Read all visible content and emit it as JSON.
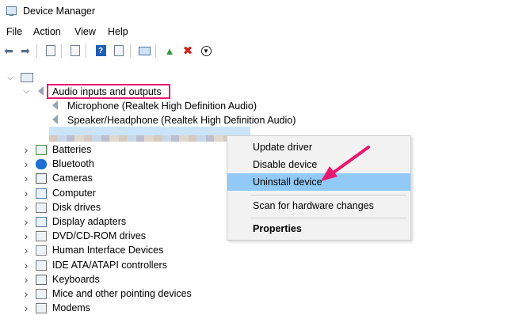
{
  "window": {
    "title": "Device Manager"
  },
  "menu": [
    "File",
    "Action",
    "View",
    "Help"
  ],
  "toolbar_icons": [
    "back-arrow-icon",
    "forward-arrow-icon",
    "properties-icon",
    "show-hide-icon",
    "help-icon",
    "details-icon",
    "monitor-icon",
    "update-driver-icon",
    "uninstall-icon",
    "download-icon"
  ],
  "tree": {
    "root_label": "",
    "audio_category": "Audio inputs and outputs",
    "audio_children": [
      "Microphone (Realtek High Definition Audio)",
      "Speaker/Headphone (Realtek High Definition Audio)"
    ],
    "categories": [
      "Batteries",
      "Bluetooth",
      "Cameras",
      "Computer",
      "Disk drives",
      "Display adapters",
      "DVD/CD-ROM drives",
      "Human Interface Devices",
      "IDE ATA/ATAPI controllers",
      "Keyboards",
      "Mice and other pointing devices",
      "Modems"
    ]
  },
  "context_menu": {
    "items": [
      "Update driver",
      "Disable device",
      "Uninstall device",
      "Scan for hardware changes",
      "Properties"
    ],
    "highlighted": "Uninstall device"
  },
  "colors": {
    "annotation": "#e8186f",
    "menu_highlight": "#91c9f7",
    "selection": "#cce4f7"
  }
}
